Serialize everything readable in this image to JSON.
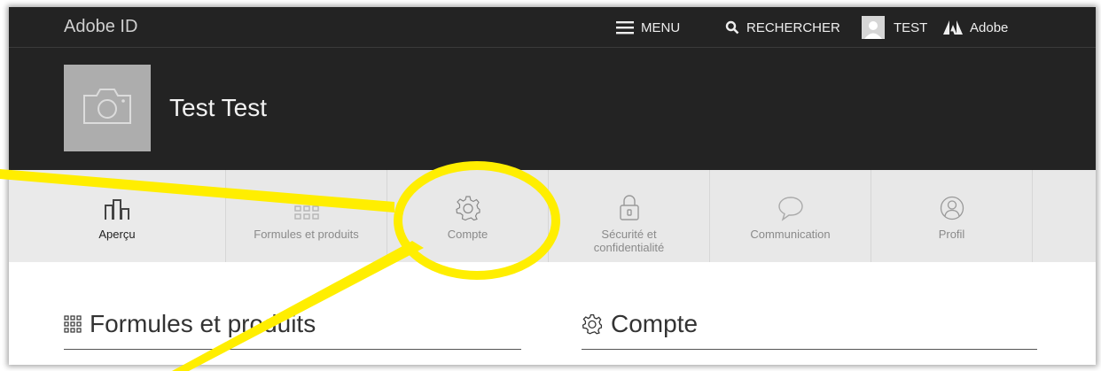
{
  "header": {
    "brand": "Adobe ID",
    "menu_label": "MENU",
    "search_label": "RECHERCHER",
    "user_label": "TEST",
    "adobe_label": "Adobe"
  },
  "profile": {
    "name": "Test Test"
  },
  "tabs": [
    {
      "label": "Aperçu",
      "icon": "overview-icon",
      "active": true
    },
    {
      "label": "Formules et produits",
      "icon": "grid-icon",
      "active": false
    },
    {
      "label": "Compte",
      "icon": "gear-icon",
      "active": false
    },
    {
      "label": "Sécurité et confidentialité",
      "icon": "lock-icon",
      "active": false
    },
    {
      "label": "Communication",
      "icon": "speech-bubble-icon",
      "active": false
    },
    {
      "label": "Profil",
      "icon": "user-icon",
      "active": false
    }
  ],
  "sections": {
    "left_title": "Formules et produits",
    "right_title": "Compte"
  },
  "annotation": {
    "highlight_color": "#ffee00",
    "target": "Compte"
  }
}
